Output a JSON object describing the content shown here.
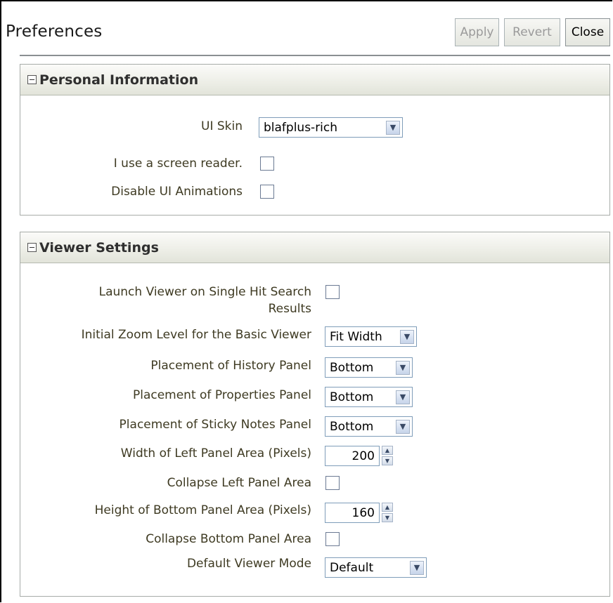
{
  "page": {
    "title": "Preferences",
    "buttons": {
      "apply": "Apply",
      "revert": "Revert",
      "close": "Close"
    }
  },
  "personal": {
    "header": "Personal Information",
    "ui_skin": {
      "label": "UI Skin",
      "value": "blafplus-rich"
    },
    "screen_reader": {
      "label": "I use a screen reader.",
      "checked": false
    },
    "disable_animations": {
      "label": "Disable UI Animations",
      "checked": false
    }
  },
  "viewer": {
    "header": "Viewer Settings",
    "launch_single_hit": {
      "label_line1": "Launch Viewer on Single Hit Search",
      "label_line2": "Results",
      "checked": false
    },
    "initial_zoom": {
      "label": "Initial Zoom Level for the Basic Viewer",
      "value": "Fit Width"
    },
    "history_panel": {
      "label": "Placement of History Panel",
      "value": "Bottom"
    },
    "properties_panel": {
      "label": "Placement of Properties Panel",
      "value": "Bottom"
    },
    "sticky_notes_panel": {
      "label": "Placement of Sticky Notes Panel",
      "value": "Bottom"
    },
    "left_panel_width": {
      "label": "Width of Left Panel Area (Pixels)",
      "value": "200"
    },
    "collapse_left": {
      "label": "Collapse Left Panel Area",
      "checked": false
    },
    "bottom_panel_height": {
      "label": "Height of Bottom Panel Area (Pixels)",
      "value": "160"
    },
    "collapse_bottom": {
      "label": "Collapse Bottom Panel Area",
      "checked": false
    },
    "default_mode": {
      "label": "Default Viewer Mode",
      "value": "Default"
    }
  },
  "icons": {
    "collapse": "collapse-minus-icon",
    "dropdown": "chevron-down-icon",
    "spin_up": "arrow-up-icon",
    "spin_down": "arrow-down-icon"
  }
}
